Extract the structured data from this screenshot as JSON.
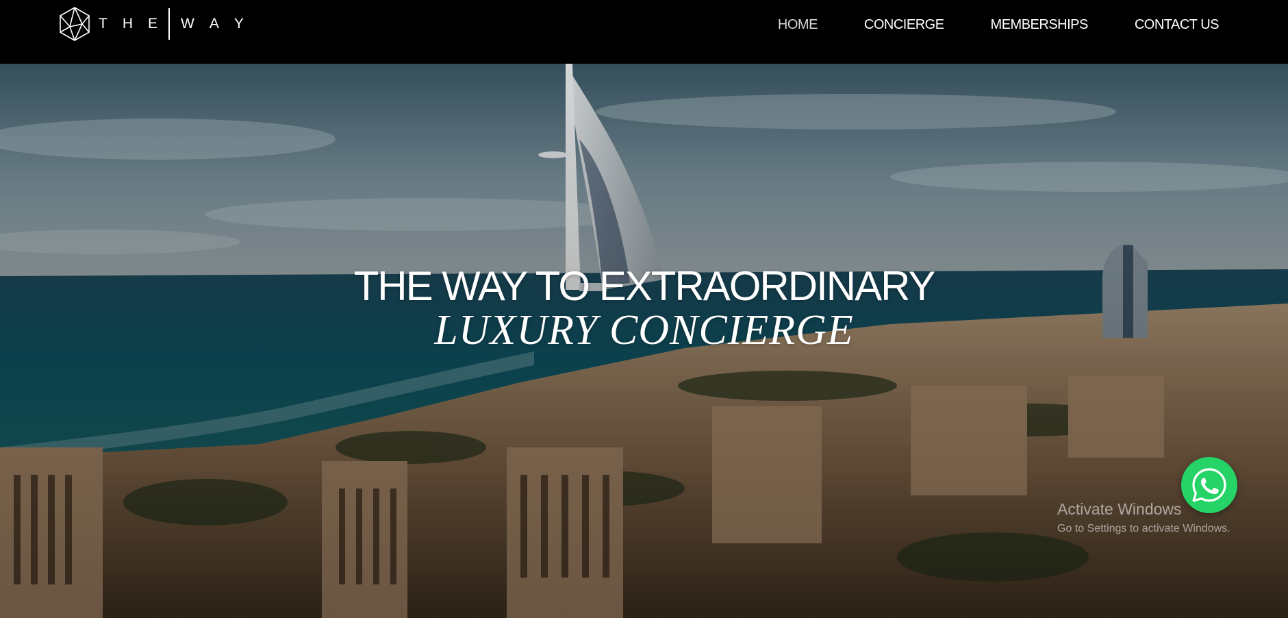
{
  "header": {
    "logo": {
      "icon": "geometric-polyhedron-logo",
      "word_left": [
        "T",
        "H",
        "E"
      ],
      "word_right": [
        "W",
        "A",
        "Y"
      ]
    },
    "nav": [
      {
        "label": "HOME",
        "active": true
      },
      {
        "label": "CONCIERGE",
        "active": false
      },
      {
        "label": "MEMBERSHIPS",
        "active": false
      },
      {
        "label": "CONTACT US",
        "active": false
      }
    ]
  },
  "hero": {
    "headline": "THE WAY TO EXTRAORDINARY",
    "subheadline": "LUXURY CONCIERGE",
    "background": "aerial-dubai-coastline-photo"
  },
  "whatsapp": {
    "icon": "whatsapp-icon",
    "color": "#25d366"
  },
  "watermark": {
    "title": "Activate Windows",
    "subtitle": "Go to Settings to activate Windows."
  },
  "colors": {
    "header_bg": "#000000",
    "text": "#ffffff"
  }
}
